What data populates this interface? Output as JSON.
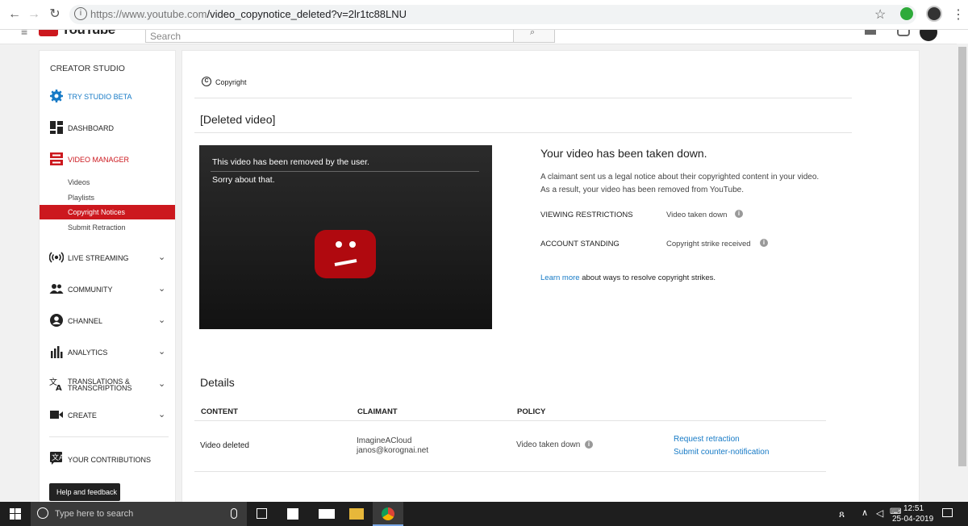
{
  "browser": {
    "url_host": "https://www.youtube.com",
    "url_path": "/video_copynotice_deleted?v=2lr1tc88LNU"
  },
  "yt_header": {
    "search_placeholder": "Search"
  },
  "sidebar": {
    "title": "CREATOR STUDIO",
    "try_beta": "TRY STUDIO BETA",
    "dashboard": "DASHBOARD",
    "video_manager": "VIDEO MANAGER",
    "sub_items": [
      "Videos",
      "Playlists",
      "Copyright Notices",
      "Submit Retraction"
    ],
    "live_streaming": "LIVE STREAMING",
    "community": "COMMUNITY",
    "channel": "CHANNEL",
    "analytics": "ANALYTICS",
    "translations_1": "TRANSLATIONS &",
    "translations_2": "TRANSCRIPTIONS",
    "create": "CREATE",
    "contributions": "YOUR CONTRIBUTIONS",
    "help": "Help and feedback"
  },
  "main": {
    "breadcrumb": "Copyright",
    "video_title": "[Deleted video]",
    "player_line1": "This video has been removed by the user.",
    "player_line2": "Sorry about that.",
    "takedown_heading": "Your video has been taken down.",
    "takedown_text1": "A claimant sent us a legal notice about their copyrighted content in your video.",
    "takedown_text2": "As a result, your video has been removed from YouTube.",
    "viewing_label": "VIEWING RESTRICTIONS",
    "viewing_value": "Video taken down",
    "standing_label": "ACCOUNT STANDING",
    "standing_value": "Copyright strike received",
    "learn_more_link": "Learn more",
    "learn_more_rest": "about ways to resolve copyright strikes."
  },
  "details": {
    "heading": "Details",
    "col_content": "CONTENT",
    "col_claimant": "CLAIMANT",
    "col_policy": "POLICY",
    "content": "Video deleted",
    "claimant_name": "ImagineACloud",
    "claimant_email": "janos@korognai.net",
    "policy": "Video taken down",
    "action1": "Request retraction",
    "action2": "Submit counter-notification"
  },
  "taskbar": {
    "search_placeholder": "Type here to search",
    "time": "12:51",
    "date": "25-04-2019"
  },
  "colors": {
    "yt_red": "#cc181e",
    "link_blue": "#167ac6"
  }
}
